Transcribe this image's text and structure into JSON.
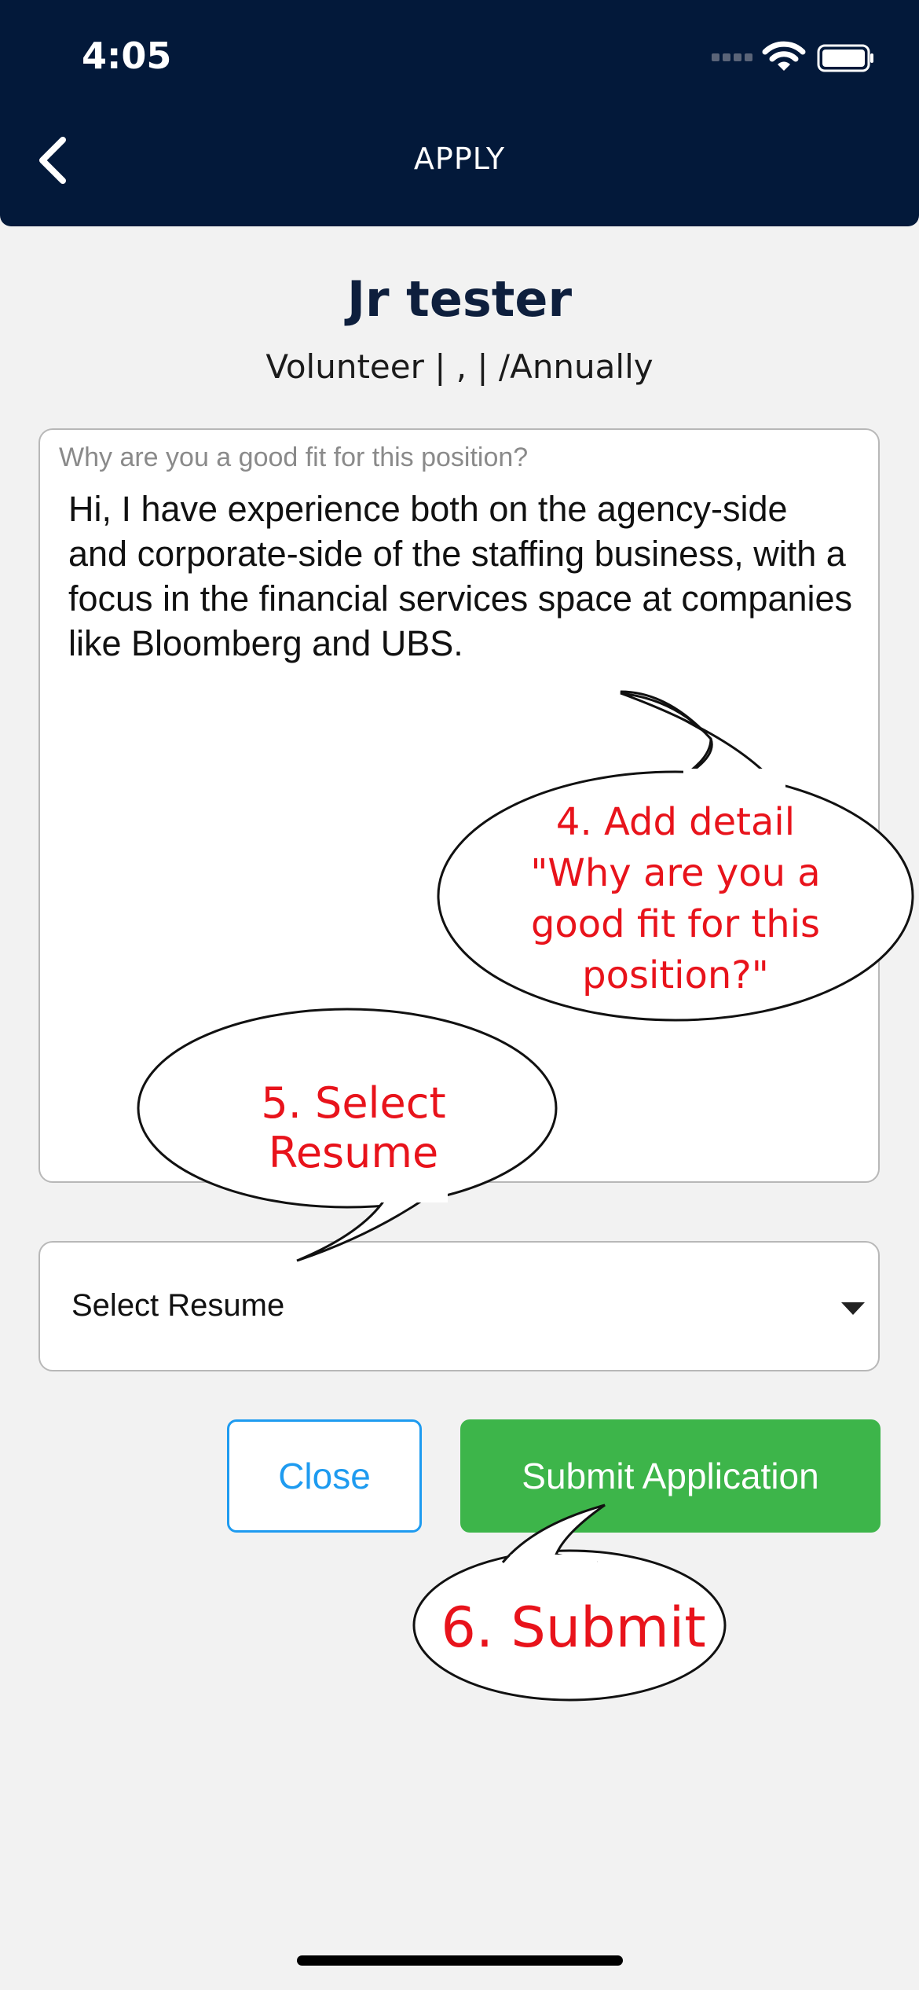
{
  "status_bar": {
    "time": "4:05"
  },
  "header": {
    "title": "APPLY",
    "back_icon": "chevron-left-icon"
  },
  "job": {
    "title": "Jr tester",
    "meta": "Volunteer | ,  | /Annually"
  },
  "fit_field": {
    "label": "Why are you a good fit for this position?",
    "value": "Hi, I have experience both on the agency-side and corporate-side of the staffing business, with a focus in the financial services space at companies like Bloomberg and UBS."
  },
  "resume_select": {
    "selected": "Select Resume"
  },
  "buttons": {
    "close": "Close",
    "submit": "Submit Application"
  },
  "annotations": {
    "step4": "4. Add detail \"Why are you a good fit for this position?\"",
    "step5": "5. Select Resume",
    "step6": "6. Submit"
  },
  "colors": {
    "header_bg": "#03193a",
    "page_bg": "#f2f2f2",
    "close_accent": "#1e9bf0",
    "submit_bg": "#3db54a",
    "annotation_text": "#e8131b"
  }
}
